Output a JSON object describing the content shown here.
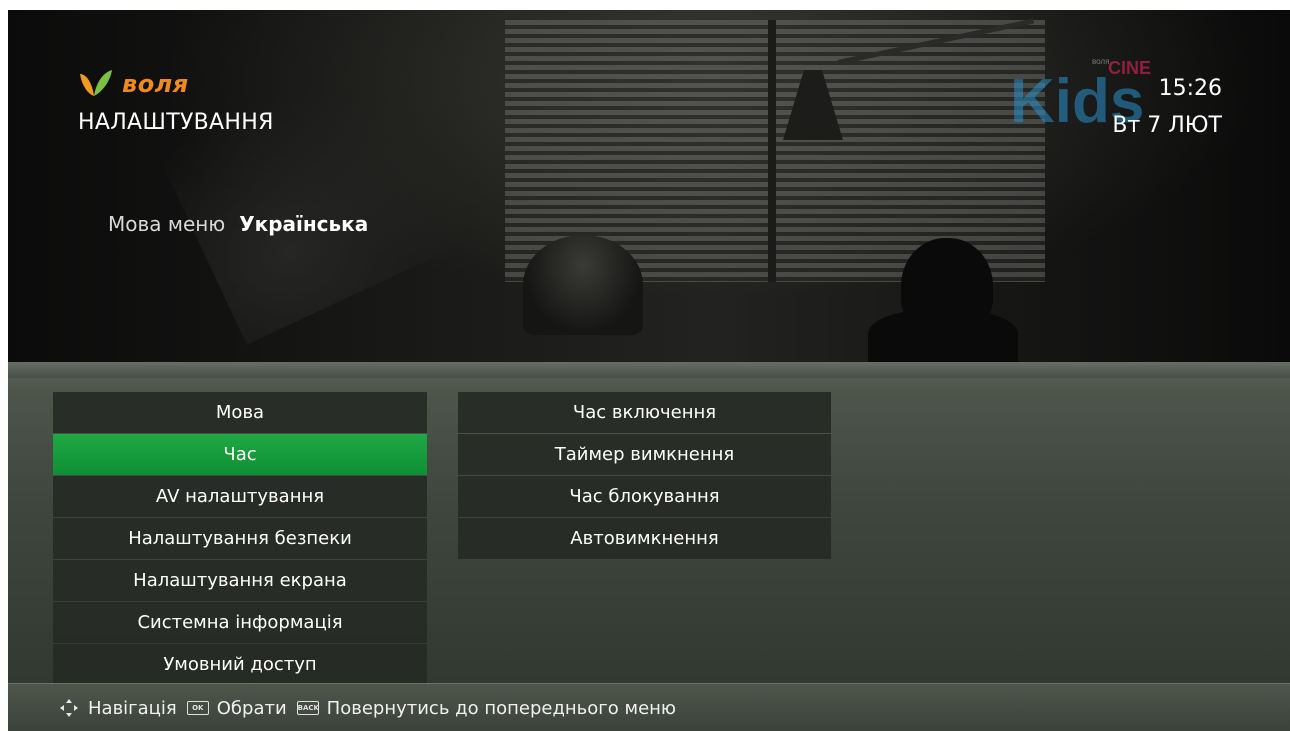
{
  "header": {
    "brand": "воля",
    "title": "НАЛАШТУВАННЯ",
    "time": "15:26",
    "date": "Вт 7 ЛЮТ",
    "channel_logo_text": "Kids",
    "channel_logo_sub": "CINE",
    "channel_logo_brand": "воля"
  },
  "info": {
    "label": "Мова меню",
    "value": "Українська"
  },
  "menu": {
    "left": [
      {
        "label": "Мова",
        "active": false
      },
      {
        "label": "Час",
        "active": true
      },
      {
        "label": "AV налаштування",
        "active": false
      },
      {
        "label": "Налаштування безпеки",
        "active": false
      },
      {
        "label": "Налаштування екрана",
        "active": false
      },
      {
        "label": "Системна інформація",
        "active": false
      },
      {
        "label": "Умовний доступ",
        "active": false
      }
    ],
    "right": [
      {
        "label": "Час включення"
      },
      {
        "label": "Таймер вимкнення"
      },
      {
        "label": "Час блокування"
      },
      {
        "label": "Автовимкнення"
      }
    ]
  },
  "footer": {
    "nav_label": "Навігація",
    "ok_key": "OK",
    "ok_label": "Обрати",
    "back_key": "BACK",
    "back_label": "Повернутись до попереднього меню"
  },
  "colors": {
    "accent_green": "#129a3a",
    "brand_orange": "#f08a1c"
  },
  "icons": [
    "voliya-logo-icon",
    "dpad-navigation-icon",
    "ok-key-icon",
    "back-key-icon"
  ]
}
